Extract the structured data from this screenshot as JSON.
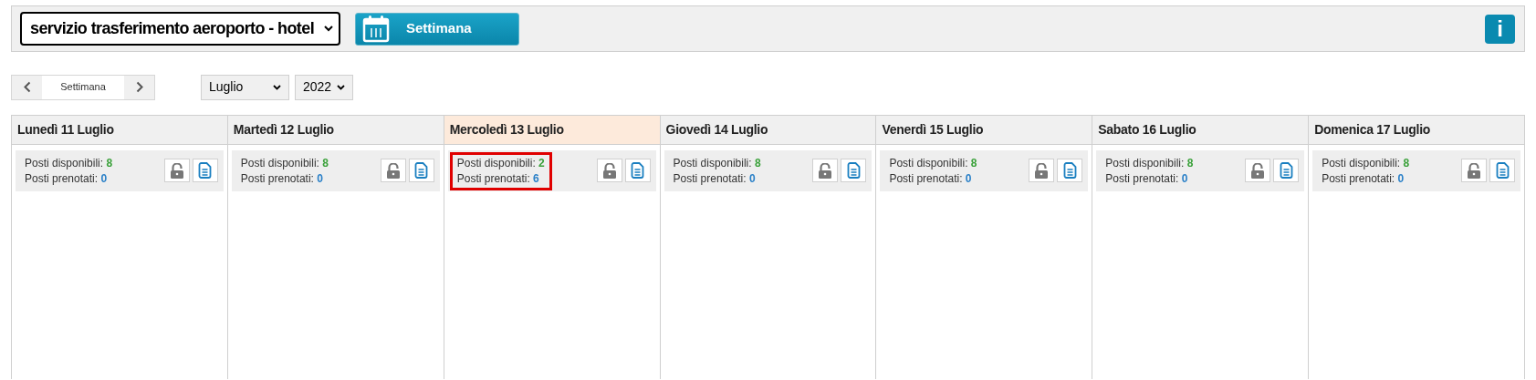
{
  "toolbar": {
    "service": "servizio trasferimento aeroporto - hotel",
    "view_button": "Settimana",
    "info_button": "i"
  },
  "navigation": {
    "period": "Settimana",
    "month": "Luglio",
    "year": "2022"
  },
  "days": [
    {
      "title": "Lunedì 11 Luglio",
      "today": false,
      "available_label": "Posti disponibili:",
      "available": "8",
      "booked_label": "Posti prenotati:",
      "booked": "0",
      "highlighted": false
    },
    {
      "title": "Martedì 12 Luglio",
      "today": false,
      "available_label": "Posti disponibili:",
      "available": "8",
      "booked_label": "Posti prenotati:",
      "booked": "0",
      "highlighted": false
    },
    {
      "title": "Mercoledì 13 Luglio",
      "today": true,
      "available_label": "Posti disponibili:",
      "available": "2",
      "booked_label": "Posti prenotati:",
      "booked": "6",
      "highlighted": true
    },
    {
      "title": "Giovedì 14 Luglio",
      "today": false,
      "available_label": "Posti disponibili:",
      "available": "8",
      "booked_label": "Posti prenotati:",
      "booked": "0",
      "highlighted": false
    },
    {
      "title": "Venerdì 15 Luglio",
      "today": false,
      "available_label": "Posti disponibili:",
      "available": "8",
      "booked_label": "Posti prenotati:",
      "booked": "0",
      "highlighted": false
    },
    {
      "title": "Sabato 16 Luglio",
      "today": false,
      "available_label": "Posti disponibili:",
      "available": "8",
      "booked_label": "Posti prenotati:",
      "booked": "0",
      "highlighted": false
    },
    {
      "title": "Domenica 17 Luglio",
      "today": false,
      "available_label": "Posti disponibili:",
      "available": "8",
      "booked_label": "Posti prenotati:",
      "booked": "0",
      "highlighted": false
    }
  ]
}
